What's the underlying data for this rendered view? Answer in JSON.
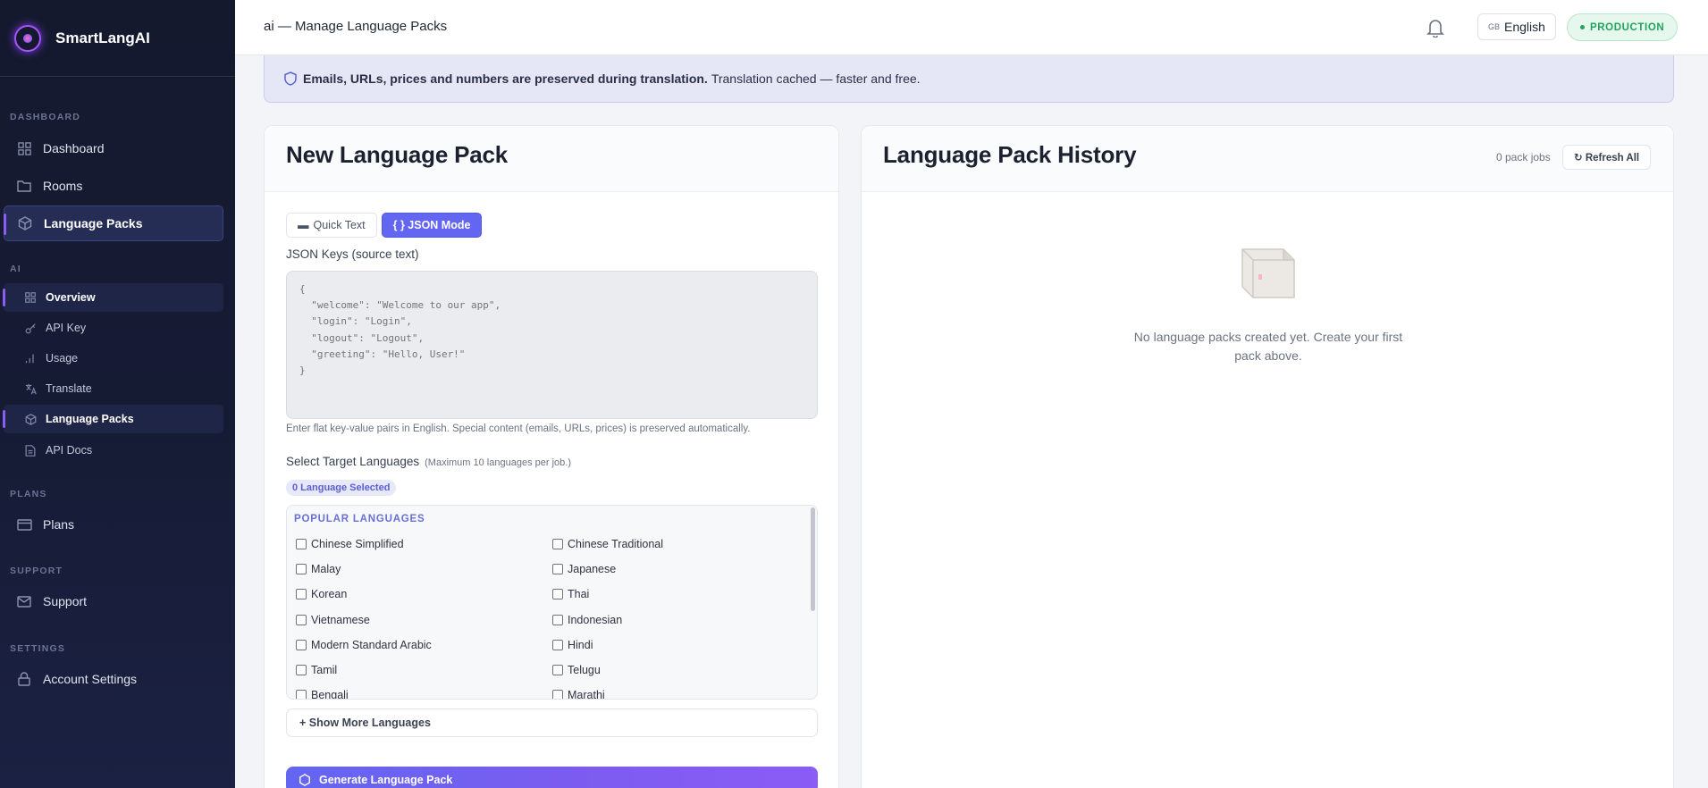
{
  "brand": {
    "name": "SmartLangAI"
  },
  "sidebar": {
    "sections": {
      "dashboard": "DASHBOARD",
      "ai": "AI",
      "plans": "PLANS",
      "support": "SUPPORT",
      "settings": "SETTINGS"
    },
    "main_items": [
      {
        "label": "Dashboard",
        "icon": "grid-icon"
      },
      {
        "label": "Rooms",
        "icon": "folder-icon"
      },
      {
        "label": "Language Packs",
        "icon": "package-icon",
        "active": true
      }
    ],
    "ai_items": [
      {
        "label": "Overview",
        "icon": "grid-icon",
        "active": true
      },
      {
        "label": "API Key",
        "icon": "key-icon"
      },
      {
        "label": "Usage",
        "icon": "bar-chart-icon"
      },
      {
        "label": "Translate",
        "icon": "translate-icon"
      },
      {
        "label": "Language Packs",
        "icon": "package-icon",
        "active": true
      },
      {
        "label": "API Docs",
        "icon": "document-icon"
      }
    ],
    "plans_item": {
      "label": "Plans",
      "icon": "card-icon"
    },
    "support_item": {
      "label": "Support",
      "icon": "mail-icon"
    },
    "settings_item": {
      "label": "Account Settings",
      "icon": "lock-icon"
    }
  },
  "header": {
    "title": "ai — Manage Language Packs",
    "language": {
      "flag": "GB",
      "label": "English"
    },
    "environment": "PRODUCTION"
  },
  "banner": {
    "bold": "Emails, URLs, prices and numbers are preserved during translation.",
    "text": "Translation cached — faster and free."
  },
  "new_pack": {
    "title": "New Language Pack",
    "tabs": {
      "quick": "Quick Text",
      "json": "{ } JSON Mode"
    },
    "json_label": "JSON Keys (source text)",
    "json_placeholder": "{\n  \"welcome\": \"Welcome to our app\",\n  \"login\": \"Login\",\n  \"logout\": \"Logout\",\n  \"greeting\": \"Hello, User!\"\n}",
    "json_hint": "Enter flat key-value pairs in English. Special content (emails, URLs, prices) is preserved automatically.",
    "select_label": "Select Target Languages",
    "select_sub": "(Maximum 10 languages per job.)",
    "selected_count": "0 Language Selected",
    "group_title": "POPULAR LANGUAGES",
    "languages": [
      "Chinese Simplified",
      "Chinese Traditional",
      "Malay",
      "Japanese",
      "Korean",
      "Thai",
      "Vietnamese",
      "Indonesian",
      "Modern Standard Arabic",
      "Hindi",
      "Tamil",
      "Telugu",
      "Bengali",
      "Marathi"
    ],
    "show_more": "+ Show More Languages",
    "generate": "Generate Language Pack"
  },
  "history": {
    "title": "Language Pack History",
    "count": "0 pack jobs",
    "refresh": "↻ Refresh All",
    "empty": "No language packs created yet. Create your first pack above."
  },
  "colors": {
    "accent": "#6366f1",
    "sidebar_bg": "#15192e",
    "production": "#22a45d"
  }
}
